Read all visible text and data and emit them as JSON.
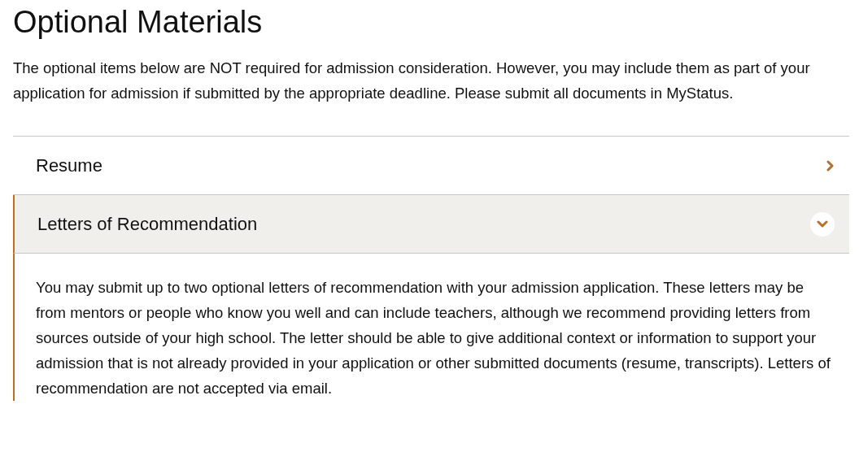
{
  "title": "Optional Materials",
  "intro": "The optional items below are NOT required for admission consideration. However, you may include them as part of your application for admission if submitted by the appropriate deadline. Please submit all documents in MyStatus.",
  "accordion": [
    {
      "label": "Resume",
      "expanded": false
    },
    {
      "label": "Letters of Recommendation",
      "expanded": true,
      "body": "You may submit up to two optional letters of recommendation with your admission application. These letters may be from mentors or people who know you well and can include teachers, although we recommend providing letters from sources outside of your high school. The letter should be able to give additional context or information to support your admission that is not already provided in your application or other submitted documents (resume, transcripts). Letters of recommendation are not accepted via email."
    }
  ]
}
